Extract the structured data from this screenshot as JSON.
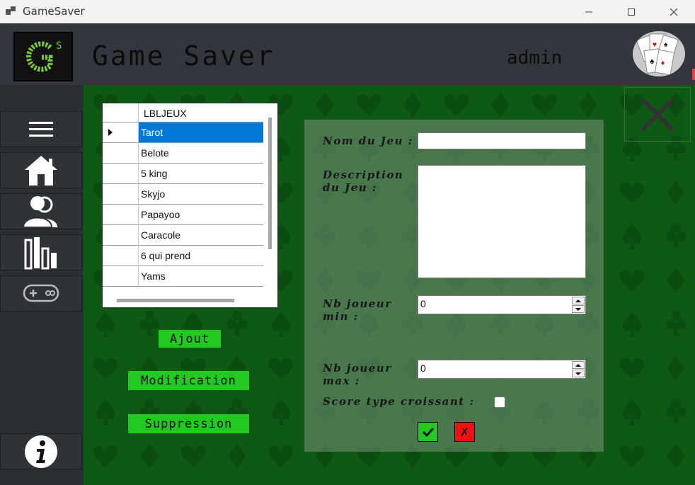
{
  "window": {
    "title": "GameSaver"
  },
  "header": {
    "logo_text": "GS",
    "app_name": "Game Saver",
    "user": "admin"
  },
  "sidebar": {
    "items": [
      {
        "name": "menu-icon"
      },
      {
        "name": "home-icon"
      },
      {
        "name": "users-icon"
      },
      {
        "name": "stats-icon"
      },
      {
        "name": "gamepad-icon"
      },
      {
        "name": "info-icon"
      }
    ]
  },
  "grid": {
    "column_header": "LBLJEUX",
    "rows": [
      "Tarot",
      "Belote",
      "5 king",
      "Skyjo",
      "Papayoo",
      "Caracole",
      "6 qui prend",
      "Yams"
    ],
    "selected_index": 0
  },
  "actions": {
    "add": "Ajout",
    "edit": "Modification",
    "delete": "Suppression"
  },
  "form": {
    "name_label": "Nom du Jeu :",
    "name_value": "",
    "desc_label": "Description\ndu Jeu :",
    "desc_value": "",
    "min_label": "Nb joueur\nmin :",
    "min_value": "0",
    "max_label": "Nb joueur\nmax :",
    "max_value": "0",
    "score_label": "Score type croissant :",
    "cancel_symbol": "✗"
  },
  "colors": {
    "background": "#0e5a14",
    "button_green": "#21c921",
    "cancel_red": "#ef1010",
    "selection": "#0078d7"
  }
}
